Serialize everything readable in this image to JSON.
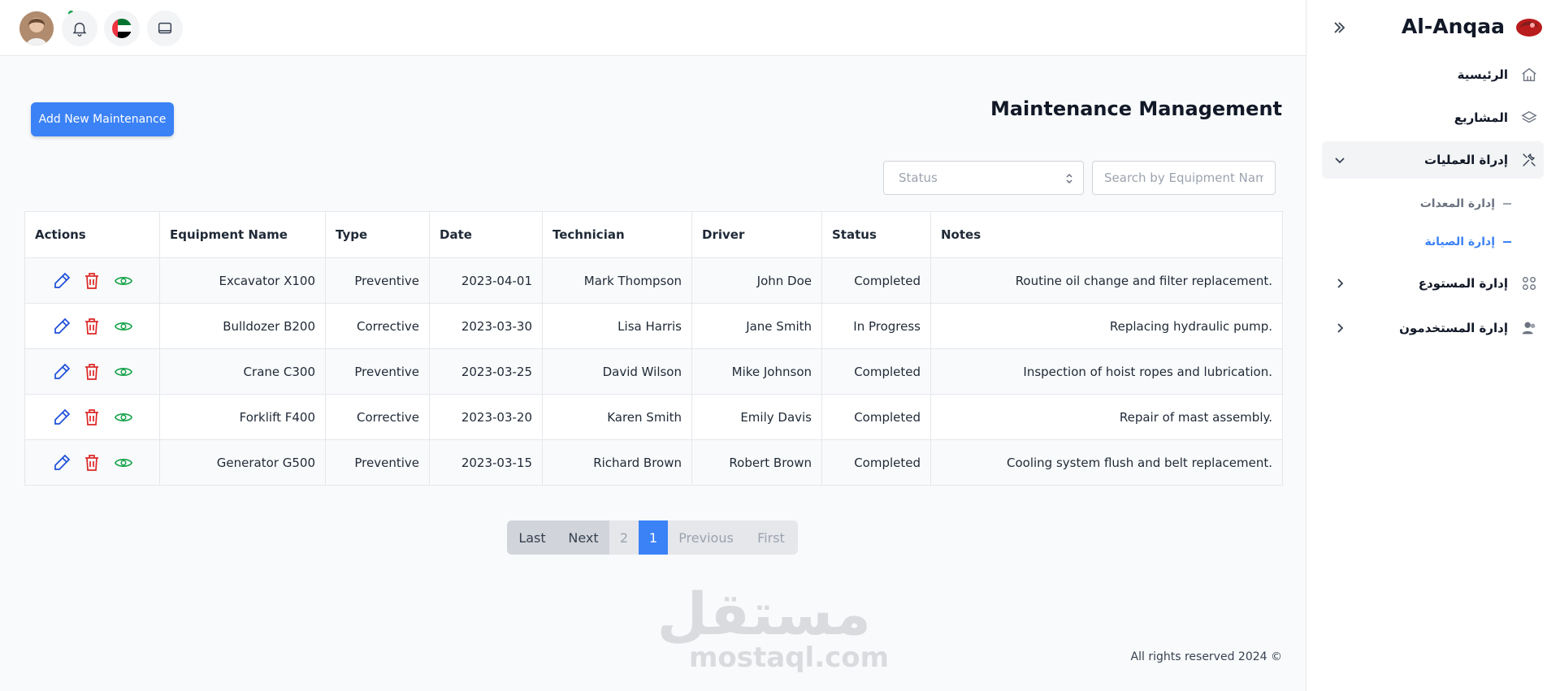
{
  "brand": {
    "name": "Al-Anqaa"
  },
  "sidebar": {
    "items": [
      {
        "label": "الرئيسية",
        "icon": "home-icon"
      },
      {
        "label": "المشاريع",
        "icon": "layers-icon"
      },
      {
        "label": "إدراة العمليات",
        "icon": "tools-icon"
      },
      {
        "label": "إدارة المستودع",
        "icon": "grid-icon"
      },
      {
        "label": "إدارة المستخدمون",
        "icon": "users-icon"
      }
    ],
    "subitems": [
      {
        "label": "إدارة المعدات"
      },
      {
        "label": "إدارة الصيانة"
      }
    ]
  },
  "page": {
    "title": "Maintenance Management",
    "add_button": "Add New Maintenance",
    "search_placeholder": "Search by Equipment Name",
    "status_placeholder": "Status",
    "footer": "All rights reserved 2024 ©"
  },
  "table": {
    "headers": [
      "Actions",
      "Equipment Name",
      "Type",
      "Date",
      "Technician",
      "Driver",
      "Status",
      "Notes"
    ],
    "rows": [
      [
        "Excavator X100",
        "Preventive",
        "2023-04-01",
        "Mark Thompson",
        "John Doe",
        "Completed",
        "Routine oil change and filter replacement."
      ],
      [
        "Bulldozer B200",
        "Corrective",
        "2023-03-30",
        "Lisa Harris",
        "Jane Smith",
        "In Progress",
        "Replacing hydraulic pump."
      ],
      [
        "Crane C300",
        "Preventive",
        "2023-03-25",
        "David Wilson",
        "Mike Johnson",
        "Completed",
        "Inspection of hoist ropes and lubrication."
      ],
      [
        "Forklift F400",
        "Corrective",
        "2023-03-20",
        "Karen Smith",
        "Emily Davis",
        "Completed",
        "Repair of mast assembly."
      ],
      [
        "Generator G500",
        "Preventive",
        "2023-03-15",
        "Richard Brown",
        "Robert Brown",
        "Completed",
        "Cooling system flush and belt replacement."
      ]
    ]
  },
  "pagination": {
    "last": "Last",
    "next": "Next",
    "page2": "2",
    "page1": "1",
    "previous": "Previous",
    "first": "First"
  },
  "watermark": {
    "ar": "مستقل",
    "en": "mostaql.com"
  },
  "colors": {
    "primary": "#3b82f6",
    "edit": "#1d4ed8",
    "delete": "#dc2626",
    "view": "#16a34a"
  }
}
